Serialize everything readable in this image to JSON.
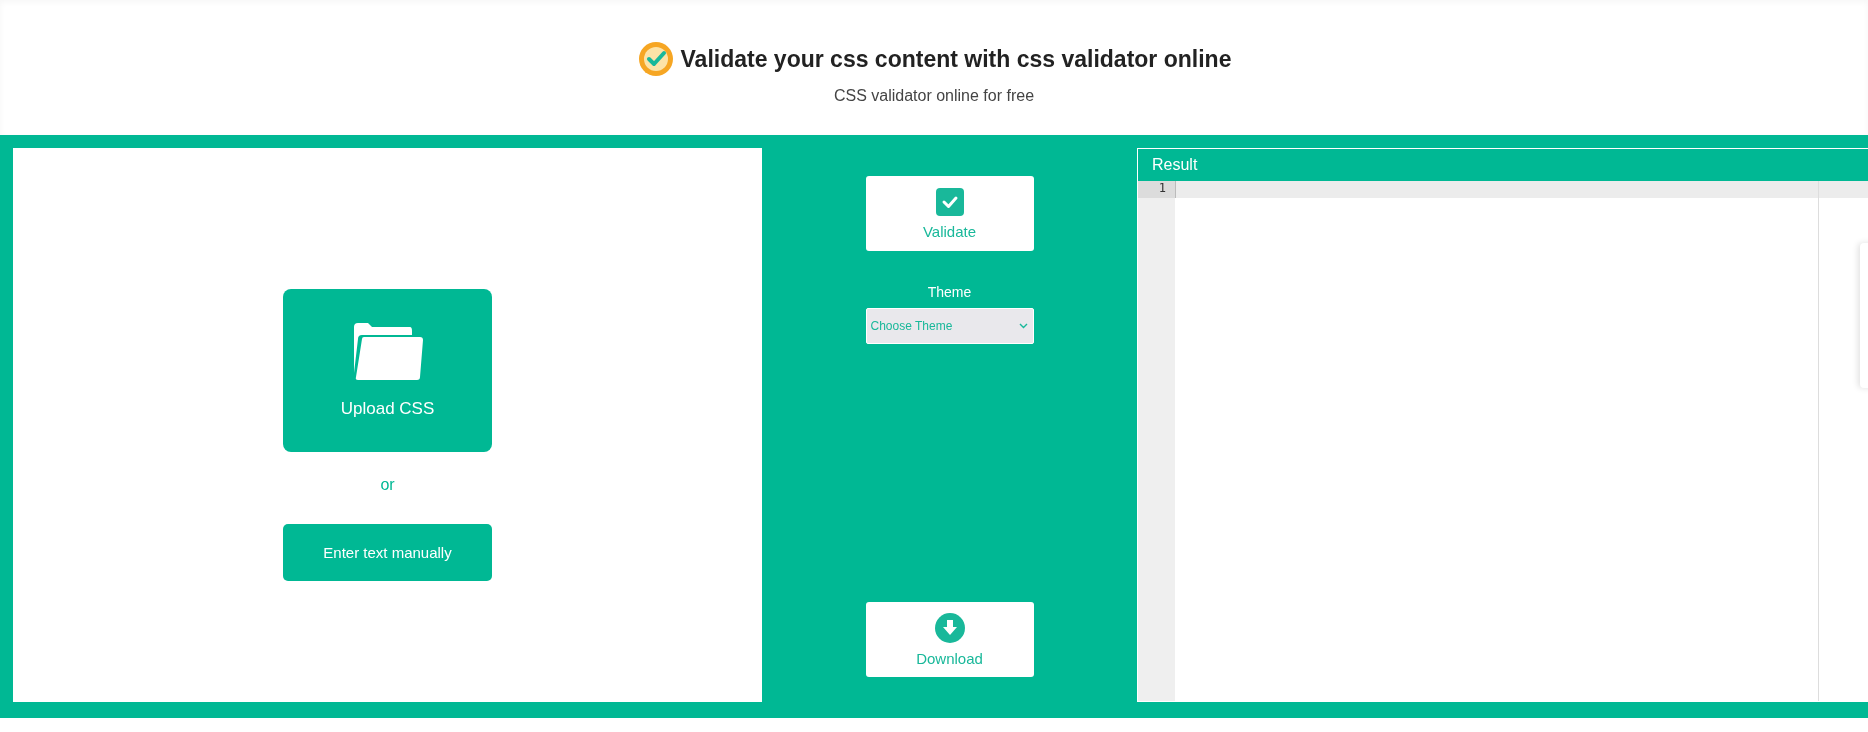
{
  "header": {
    "title": "Validate your css content with css validator online",
    "subtitle": "CSS validator online for free"
  },
  "input_panel": {
    "upload_label": "Upload CSS",
    "separator": "or",
    "manual_button": "Enter text manually"
  },
  "actions": {
    "validate": "Validate",
    "theme_label": "Theme",
    "theme_placeholder": "Choose Theme",
    "download": "Download"
  },
  "result": {
    "title": "Result",
    "line_numbers": [
      "1"
    ]
  }
}
